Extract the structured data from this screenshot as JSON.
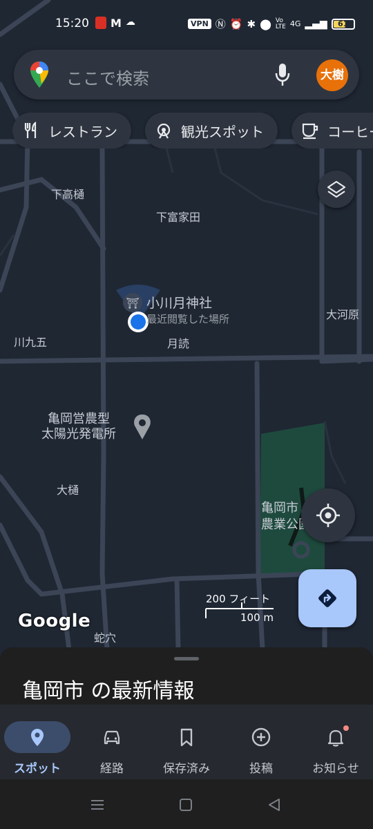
{
  "status_bar": {
    "time": "15:20",
    "vpn": "VPN",
    "network": "4G",
    "battery": "61",
    "battery_level": 0.61
  },
  "search": {
    "placeholder": "ここで検索",
    "avatar_text": "大樹",
    "avatar_color": "#e8710a"
  },
  "chips": [
    {
      "label": "レストラン",
      "icon": "restaurant-icon"
    },
    {
      "label": "観光スポット",
      "icon": "attraction-icon"
    },
    {
      "label": "コーヒー",
      "icon": "coffee-icon"
    }
  ],
  "map": {
    "labels": {
      "shimotakahi": "下高樋",
      "shimotomiyoshida": "下富家田",
      "kawakugo": "川九五",
      "tsukuyomi": "月読",
      "okawara": "大河原",
      "otoi": "大樋",
      "jaana": "蛇穴"
    },
    "shrine": {
      "name": "小川月神社",
      "subtitle": "最近閲覧した場所"
    },
    "solar": {
      "line1": "亀岡営農型",
      "line2": "太陽光発電所"
    },
    "park": {
      "line1": "亀岡市",
      "line2": "農業公園"
    },
    "scale_ft": "200 フィート",
    "scale_m": "100 m",
    "attribution": "Google"
  },
  "sheet": {
    "title": "亀岡市 の最新情報"
  },
  "bottom_nav": [
    {
      "label": "スポット",
      "icon": "location-pin-icon",
      "active": true
    },
    {
      "label": "経路",
      "icon": "car-icon",
      "active": false
    },
    {
      "label": "保存済み",
      "icon": "bookmark-icon",
      "active": false
    },
    {
      "label": "投稿",
      "icon": "add-circle-icon",
      "active": false
    },
    {
      "label": "お知らせ",
      "icon": "bell-icon",
      "active": false
    }
  ],
  "colors": {
    "map_bg": "#1f2733",
    "road": "#3b4556",
    "park": "#1e4a3e",
    "accent": "#a8c7fa",
    "location_dot": "#1a73e8"
  }
}
